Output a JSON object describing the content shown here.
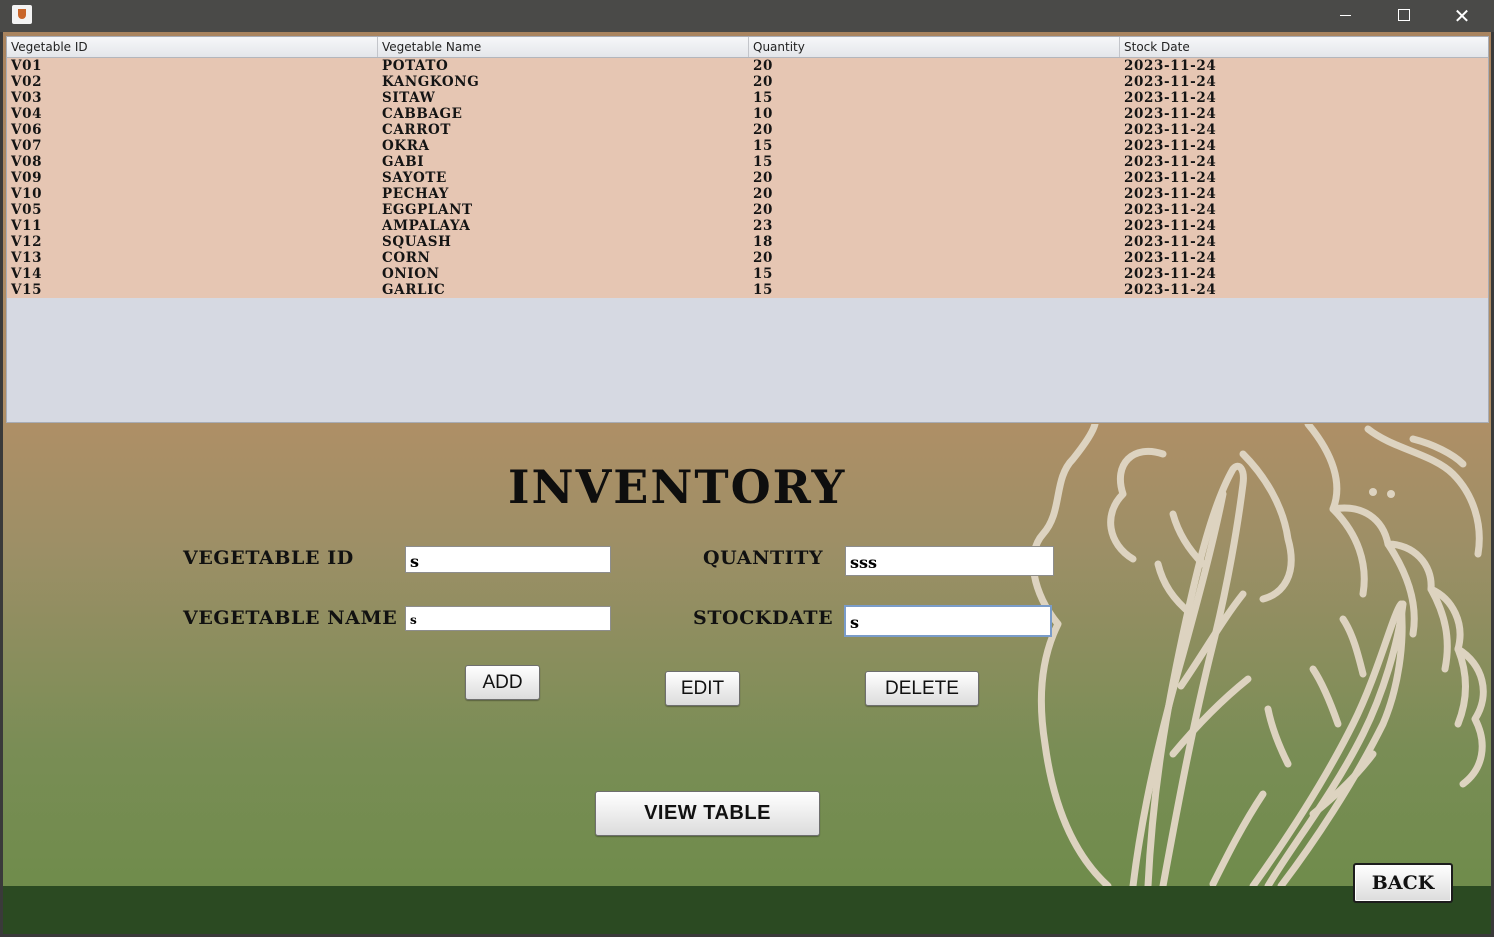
{
  "window": {
    "controls": {
      "minimize": "minimize-icon",
      "maximize": "maximize-icon",
      "close": "✕"
    },
    "icon": "java-app-icon"
  },
  "table": {
    "columns": [
      "Vegetable ID",
      "Vegetable Name",
      "Quantity",
      "Stock Date"
    ],
    "rows": [
      {
        "id": "V01",
        "name": "POTATO",
        "qty": "20",
        "date": "2023-11-24"
      },
      {
        "id": "V02",
        "name": "KANGKONG",
        "qty": "20",
        "date": "2023-11-24"
      },
      {
        "id": "V03",
        "name": "SITAW",
        "qty": "15",
        "date": "2023-11-24"
      },
      {
        "id": "V04",
        "name": "CABBAGE",
        "qty": "10",
        "date": "2023-11-24"
      },
      {
        "id": "V06",
        "name": "CARROT",
        "qty": "20",
        "date": "2023-11-24"
      },
      {
        "id": "V07",
        "name": "OKRA",
        "qty": "15",
        "date": "2023-11-24"
      },
      {
        "id": "V08",
        "name": "GABI",
        "qty": "15",
        "date": "2023-11-24"
      },
      {
        "id": "V09",
        "name": "SAYOTE",
        "qty": "20",
        "date": "2023-11-24"
      },
      {
        "id": "V10",
        "name": "PECHAY",
        "qty": "20",
        "date": "2023-11-24"
      },
      {
        "id": "V05",
        "name": "EGGPLANT",
        "qty": "20",
        "date": "2023-11-24"
      },
      {
        "id": "V11",
        "name": "AMPALAYA",
        "qty": "23",
        "date": "2023-11-24"
      },
      {
        "id": "V12",
        "name": "SQUASH",
        "qty": "18",
        "date": "2023-11-24"
      },
      {
        "id": "V13",
        "name": "CORN",
        "qty": "20",
        "date": "2023-11-24"
      },
      {
        "id": "V14",
        "name": "ONION",
        "qty": "15",
        "date": "2023-11-24"
      },
      {
        "id": "V15",
        "name": "GARLIC",
        "qty": "15",
        "date": "2023-11-24"
      }
    ]
  },
  "form": {
    "title": "INVENTORY",
    "vegetable_id_label": "VEGETABLE ID",
    "vegetable_id_value": "s",
    "vegetable_name_label": "VEGETABLE NAME",
    "vegetable_name_value": "s",
    "quantity_label": "QUANTITY",
    "quantity_value": "sss",
    "stockdate_label": "STOCKDATE",
    "stockdate_value": "s"
  },
  "buttons": {
    "add": "ADD",
    "edit": "EDIT",
    "delete": "DELETE",
    "view_table": "VIEW TABLE",
    "back": "BACK"
  },
  "colors": {
    "table_row_bg": "#e6c6b3",
    "footer": "#2b4a22",
    "lettuce_line": "#ddd3c0"
  }
}
